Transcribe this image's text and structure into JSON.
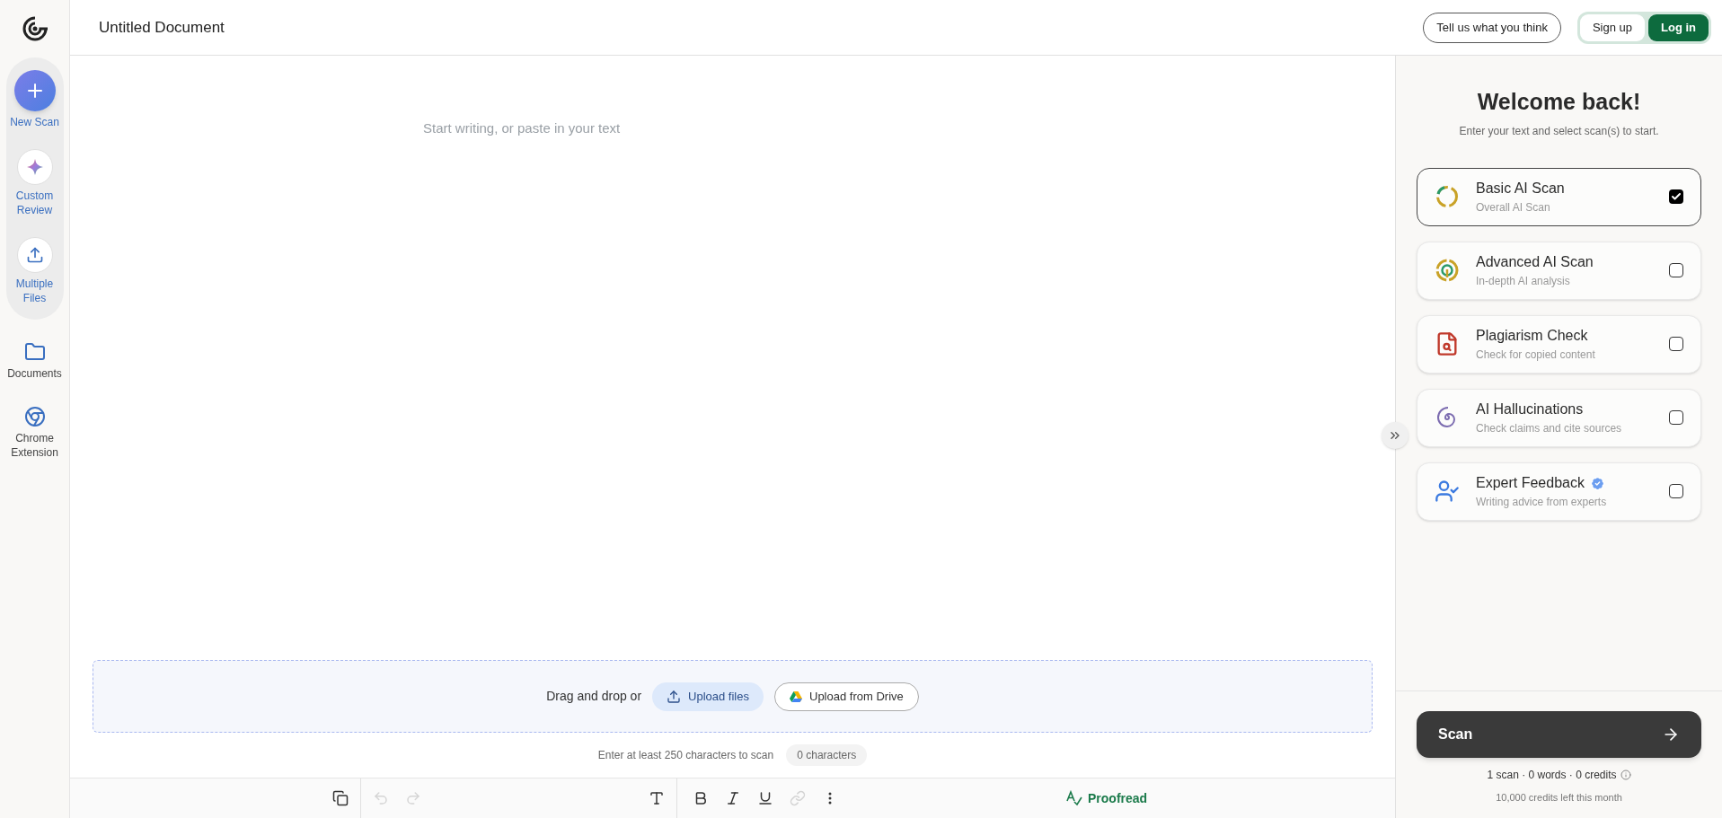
{
  "sidebar": {
    "items": [
      {
        "label": "New Scan",
        "kind": "new",
        "grouped": true
      },
      {
        "label": "Custom Review",
        "kind": "review",
        "grouped": true
      },
      {
        "label": "Multiple Files",
        "kind": "upload",
        "grouped": true
      },
      {
        "label": "Documents",
        "kind": "folder",
        "grouped": false
      },
      {
        "label": "Chrome Extension",
        "kind": "chrome",
        "grouped": false
      }
    ]
  },
  "header": {
    "title": "Untitled Document",
    "feedback": "Tell us what you think",
    "sign_up": "Sign up",
    "log_in": "Log in"
  },
  "editor": {
    "placeholder": "Start writing, or paste in your text",
    "dropzone": {
      "text": "Drag and drop or",
      "upload": "Upload files",
      "drive": "Upload from Drive"
    },
    "hint": "Enter at least 250 characters to scan",
    "count": "0 characters",
    "toolbar": [
      {
        "kind": "copy",
        "disabled": false
      },
      {
        "kind": "undo",
        "disabled": true
      },
      {
        "kind": "redo",
        "disabled": true
      },
      {
        "kind": "text",
        "disabled": false
      },
      {
        "kind": "bold",
        "disabled": false
      },
      {
        "kind": "italic",
        "disabled": false
      },
      {
        "kind": "underline",
        "disabled": false
      },
      {
        "kind": "link",
        "disabled": true
      },
      {
        "kind": "more",
        "disabled": false
      }
    ],
    "proofread": "Proofread"
  },
  "panel": {
    "title": "Welcome back!",
    "subtitle": "Enter your text and select scan(s) to start.",
    "scans": [
      {
        "kind": "basic",
        "title": "Basic AI Scan",
        "subtitle": "Overall AI Scan",
        "checked": true,
        "verified": false
      },
      {
        "kind": "advanced",
        "title": "Advanced AI Scan",
        "subtitle": "In-depth AI analysis",
        "checked": false,
        "verified": false
      },
      {
        "kind": "plagiarism",
        "title": "Plagiarism Check",
        "subtitle": "Check for copied content",
        "checked": false,
        "verified": false
      },
      {
        "kind": "hallucinations",
        "title": "AI Hallucinations",
        "subtitle": "Check claims and cite sources",
        "checked": false,
        "verified": false
      },
      {
        "kind": "expert",
        "title": "Expert Feedback",
        "subtitle": "Writing advice from experts",
        "checked": false,
        "verified": true
      }
    ],
    "scan_button": "Scan",
    "summary": "1 scan · 0 words · 0 credits",
    "credits": "10,000 credits left this month"
  }
}
